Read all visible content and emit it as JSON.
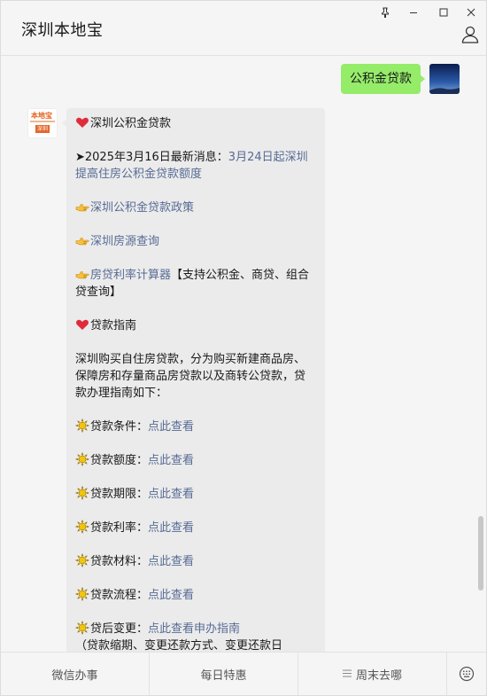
{
  "window": {
    "title": "深圳本地宝",
    "pin_label": "",
    "minimize_label": "",
    "maximize_label": "",
    "close_label": ""
  },
  "chat": {
    "sent_message": "公积金贷款",
    "received": {
      "heading": "深圳公积金贷款",
      "news_prefix": "➤2025年3月16日最新消息：",
      "news_link": "3月24日起深圳提高住房公积金贷款额度",
      "link_policy": "深圳公积金贷款政策",
      "link_housing": "深圳房源查询",
      "link_calculator": "房贷利率计算器",
      "calculator_note": "【支持公积金、商贷、组合贷查询】",
      "guide_heading": "贷款指南",
      "guide_intro": "深圳购买自住房贷款，分为购买新建商品房、保障房和存量商品房贷款以及商转公贷款，贷款办理指南如下：",
      "items": [
        {
          "label": "贷款条件：",
          "link": "点此查看"
        },
        {
          "label": "贷款额度：",
          "link": "点此查看"
        },
        {
          "label": "贷款期限：",
          "link": "点此查看"
        },
        {
          "label": "贷款利率：",
          "link": "点此查看"
        },
        {
          "label": "贷款材料：",
          "link": "点此查看"
        },
        {
          "label": "贷款流程：",
          "link": "点此查看"
        }
      ],
      "after_label": "贷后变更：",
      "after_link": "点此查看申办指南",
      "after_note": "（贷款缩期、变更还款方式、变更还款日"
    },
    "avatar_logo_text": "本地宝",
    "avatar_logo_tag": "深圳"
  },
  "menu": {
    "items": [
      "微信办事",
      "每日特惠",
      "周末去哪"
    ]
  },
  "colors": {
    "sent_bubble": "#95ec69",
    "received_bubble": "#ebebeb",
    "link": "#576b95",
    "accent_logo": "#e6652b"
  }
}
